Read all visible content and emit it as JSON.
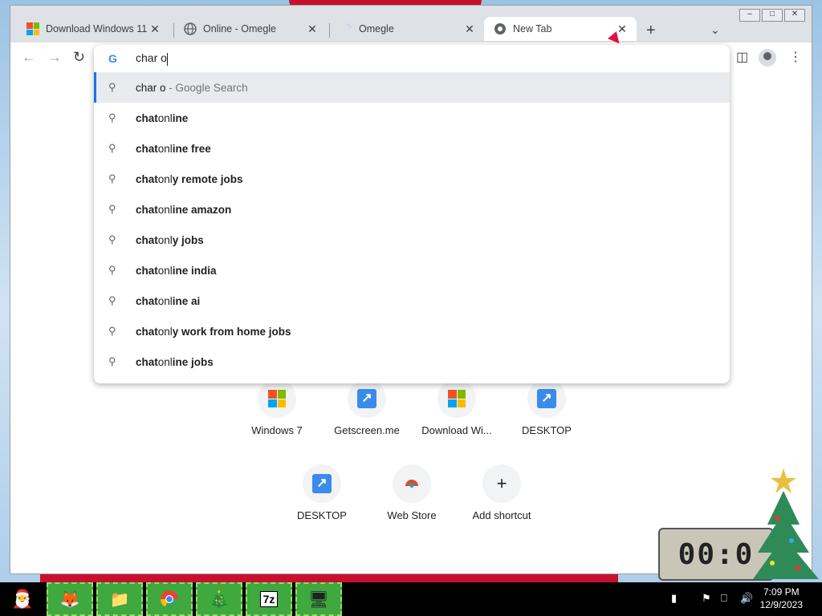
{
  "tabs": [
    {
      "label": "Download Windows 11",
      "icon": "windows-icon"
    },
    {
      "label": "Online - Omegle",
      "icon": "globe-icon"
    },
    {
      "label": "Omegle",
      "icon": "loading-icon"
    },
    {
      "label": "New Tab",
      "icon": "chrome-icon",
      "active": true
    }
  ],
  "omnibox": {
    "value": "char o",
    "selected_suggestion": {
      "text": "char o",
      "suffix": "- Google Search"
    },
    "suggestions": [
      {
        "prefix": "chat",
        "mid": " onl",
        "rest": "ine"
      },
      {
        "prefix": "chat",
        "mid": " onl",
        "rest": "ine free"
      },
      {
        "prefix": "chat",
        "mid": " onl",
        "rest": "y remote jobs"
      },
      {
        "prefix": "chat",
        "mid": " onl",
        "rest": "ine amazon"
      },
      {
        "prefix": "chat",
        "mid": " onl",
        "rest": "y jobs"
      },
      {
        "prefix": "chat",
        "mid": " onl",
        "rest": "ine india"
      },
      {
        "prefix": "chat",
        "mid": " onl",
        "rest": "ine ai"
      },
      {
        "prefix": "chat",
        "mid": " onl",
        "rest": "y work from home jobs"
      },
      {
        "prefix": "chat",
        "mid": " onl",
        "rest": "ine jobs"
      }
    ]
  },
  "shortcuts": [
    {
      "label": "Windows 7",
      "icon": "windows-icon"
    },
    {
      "label": "Getscreen.me",
      "icon": "shortcut-arrow-icon"
    },
    {
      "label": "Download Wi...",
      "icon": "windows-icon"
    },
    {
      "label": "DESKTOP",
      "icon": "shortcut-arrow-icon"
    },
    {
      "label": "DESKTOP",
      "icon": "shortcut-arrow-icon"
    },
    {
      "label": "Web Store",
      "icon": "webstore-icon"
    },
    {
      "label": "Add shortcut",
      "icon": "plus-icon"
    }
  ],
  "taskbar": {
    "time": "7:09 PM",
    "date": "12/9/2023"
  },
  "clock_widget": "00:0"
}
